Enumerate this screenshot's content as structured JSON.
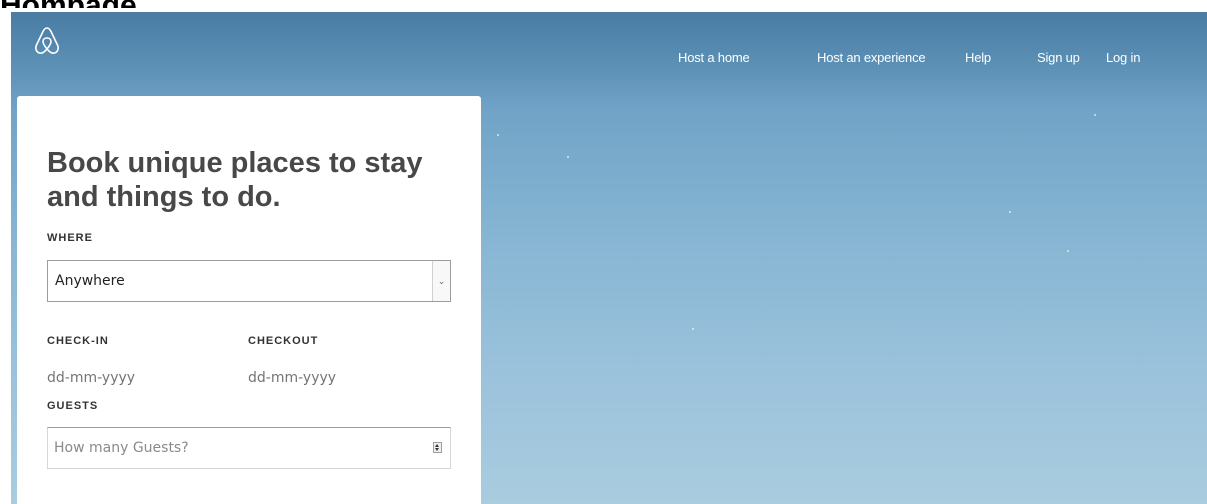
{
  "page": {
    "heading": "Hompage"
  },
  "nav": {
    "host_home": "Host a home",
    "host_experience": "Host an experience",
    "help": "Help",
    "sign_up": "Sign up",
    "log_in": "Log in"
  },
  "search_card": {
    "title": "Book unique places to stay and things to do.",
    "where_label": "WHERE",
    "where_value": "Anywhere",
    "checkin_label": "CHECK-IN",
    "checkout_label": "CHECKOUT",
    "checkin_placeholder": "dd-mm-yyyy",
    "checkout_placeholder": "dd-mm-yyyy",
    "guests_label": "GUESTS",
    "guests_placeholder": "How many Guests?"
  },
  "icons": {
    "logo": "airbnb-logo-icon",
    "select_arrow": "chevron-down-icon",
    "spinner": "spinner-icon"
  },
  "colors": {
    "nav_text": "#ffffff",
    "title_text": "#484848",
    "sky_top": "#5b8fb5",
    "sky_bottom": "#a9ccdf"
  }
}
